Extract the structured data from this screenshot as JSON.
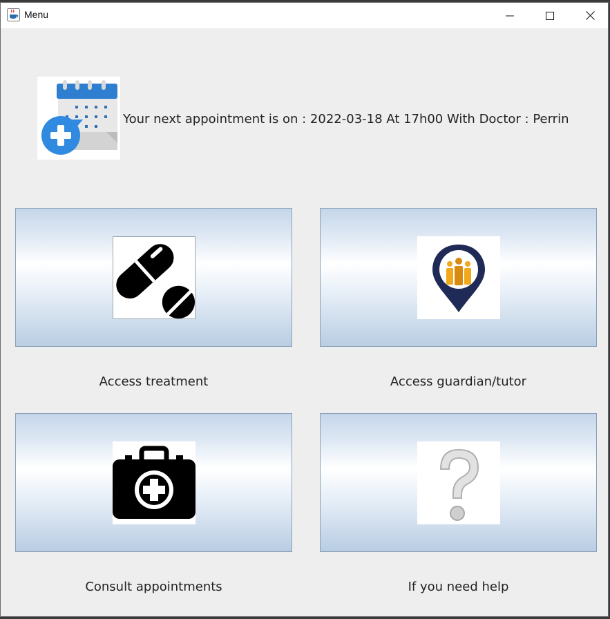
{
  "window": {
    "title": "Menu"
  },
  "appointment": {
    "text": "Your next appointment is on : 2022-03-18 At 17h00 With Doctor : Perrin"
  },
  "buttons": {
    "treatment": {
      "label": "Access treatment",
      "icon": "pill-icon"
    },
    "guardian": {
      "label": "Access guardian/tutor",
      "icon": "family-location-icon"
    },
    "appointments": {
      "label": "Consult appointments",
      "icon": "first-aid-kit-icon"
    },
    "help": {
      "label": "If you need help",
      "icon": "question-mark-icon"
    }
  }
}
